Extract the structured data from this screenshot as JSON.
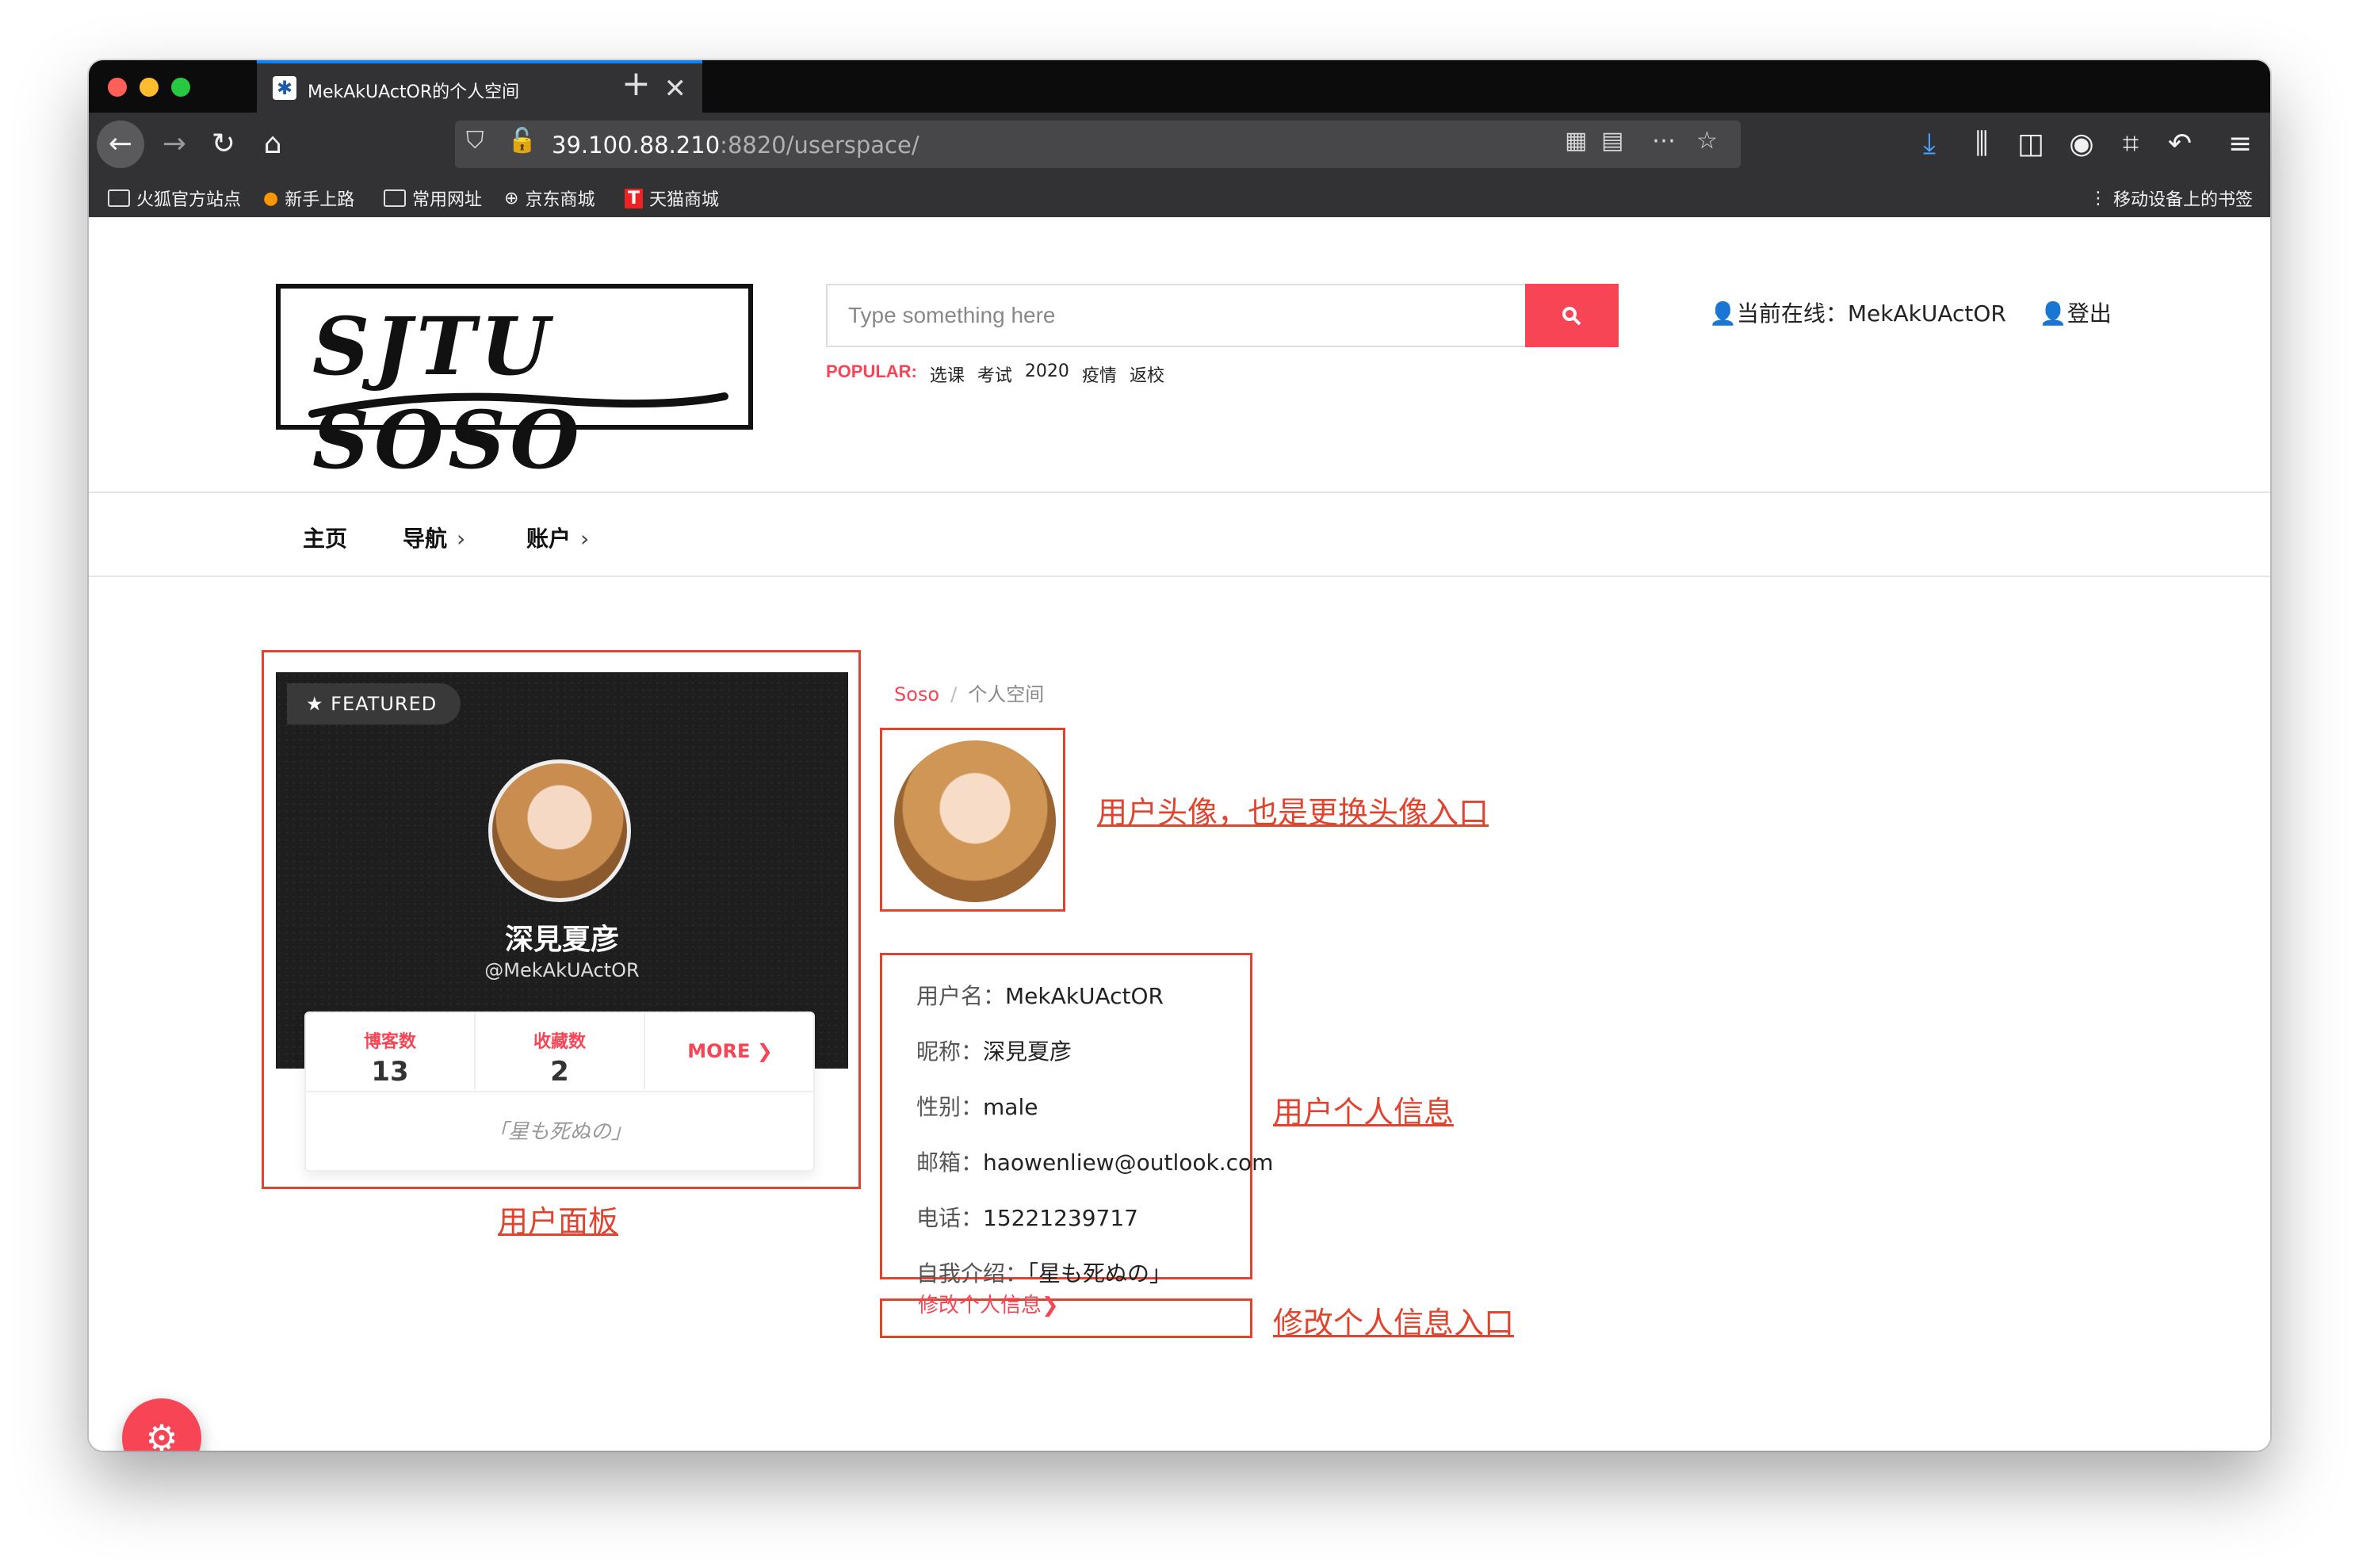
{
  "browser": {
    "tab_title": "MekAkUActOR的个人空间",
    "tab_close": "✕",
    "new_tab": "+",
    "url_host": "39.100.88.210",
    "url_rest": ":8820/userspace/",
    "bookmarks": [
      "火狐官方站点",
      "新手上路",
      "常用网址",
      "京东商城",
      "天猫商城"
    ],
    "mobile_bookmarks": "移动设备上的书签"
  },
  "header": {
    "logo_text": "SJTU SOSO",
    "search_placeholder": "Type something here",
    "popular_label": "POPULAR:",
    "popular_tags": [
      "选课",
      "考试",
      "2020",
      "疫情",
      "返校"
    ],
    "online_label": "👤当前在线：MekAkUActOR",
    "logout_label": "👤登出"
  },
  "nav": {
    "home": "主页",
    "guide": "导航",
    "account": "账户"
  },
  "panel": {
    "featured": "★ FEATURED",
    "nickname": "深見夏彦",
    "handle": "@MekAkUActOR",
    "blogs_label": "博客数",
    "blogs_value": "13",
    "favs_label": "收藏数",
    "favs_value": "2",
    "more_label": "MORE ❯",
    "motto": "「星も死ぬの」"
  },
  "breadcrumb": {
    "home": "Soso",
    "sep": "/",
    "current": "个人空间"
  },
  "info": {
    "username_key": "用户名：",
    "username": "MekAkUActOR",
    "nickname_key": "昵称：",
    "nickname": "深見夏彦",
    "gender_key": "性别：",
    "gender": "male",
    "email_key": "邮箱：",
    "email": "haowenliew@outlook.com",
    "phone_key": "电话：",
    "phone": "15221239717",
    "intro_key": "自我介绍：",
    "intro": "「星も死ぬの」",
    "edit_link": "修改个人信息❯"
  },
  "annotations": {
    "avatar": "用户头像，也是更换头像入口",
    "personal_info": "用户个人信息",
    "edit_entry": "修改个人信息入口",
    "panel": "用户面板"
  },
  "colors": {
    "accent": "#f74556",
    "annotation": "#e0442e"
  },
  "icons": {
    "fab": "gear-icon",
    "search": "search-icon"
  }
}
